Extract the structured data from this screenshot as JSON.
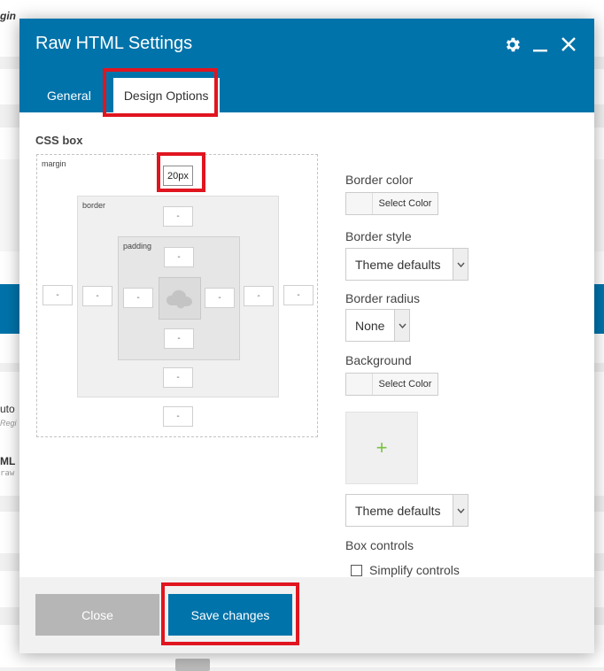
{
  "background": {
    "frag_top": "gin",
    "frag_mid1": "uto",
    "frag_mid1_sub": "Regi",
    "frag_mid2": "ML",
    "frag_mid2_sub": "raw"
  },
  "modal": {
    "title": "Raw HTML Settings",
    "icons": [
      "gear-icon",
      "minimize-icon",
      "close-icon"
    ],
    "tabs": [
      {
        "label": "General"
      },
      {
        "label": "Design Options"
      }
    ]
  },
  "css_box": {
    "title": "CSS box",
    "margin_label": "margin",
    "border_label": "border",
    "padding_label": "padding",
    "margin_top_value": "20px",
    "placeholder": "-"
  },
  "options": {
    "border_color_label": "Border color",
    "select_color_label": "Select Color",
    "border_style_label": "Border style",
    "border_style_value": "Theme defaults",
    "border_radius_label": "Border radius",
    "border_radius_value": "None",
    "background_label": "Background",
    "background_select_color": "Select Color",
    "background_style_value": "Theme defaults",
    "box_controls_label": "Box controls",
    "simplify_controls_label": "Simplify controls"
  },
  "footer": {
    "close_label": "Close",
    "save_label": "Save changes"
  },
  "colors": {
    "accent": "#0073aa",
    "highlight": "#e0151f",
    "close_button": "#b6b6b6",
    "add_plus": "#7ac143"
  }
}
